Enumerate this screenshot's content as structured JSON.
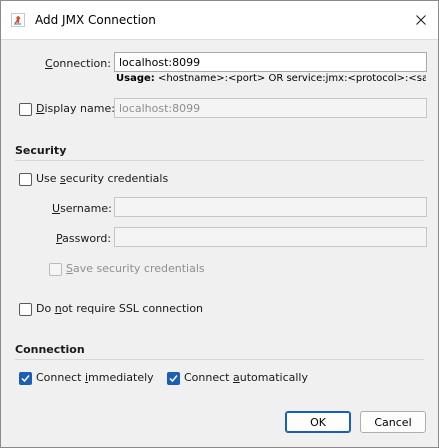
{
  "window": {
    "title": "Add JMX Connection"
  },
  "connection": {
    "label": "Connection:",
    "value": "localhost:8099",
    "usage_label": "Usage:",
    "usage_text": "<hostname>:<port> OR service:jmx:<protocol>:<sap>"
  },
  "display_name": {
    "label": "Display name:",
    "checked": false,
    "value": "localhost:8099"
  },
  "security": {
    "heading": "Security",
    "use_credentials_label": "Use security credentials",
    "username_label": "Username:",
    "username_value": "",
    "password_label": "Password:",
    "password_value": "",
    "save_credentials_label": "Save security credentials",
    "no_ssl_label": "Do not require SSL connection"
  },
  "connection_section": {
    "heading": "Connection",
    "connect_immediately_label": "Connect immediately",
    "connect_immediately_checked": true,
    "connect_automatically_label": "Connect automatically",
    "connect_automatically_checked": true
  },
  "buttons": {
    "ok": "OK",
    "cancel": "Cancel"
  },
  "colors": {
    "accent": "#1a5fb4",
    "dialog_bg": "#f0f0f0"
  }
}
